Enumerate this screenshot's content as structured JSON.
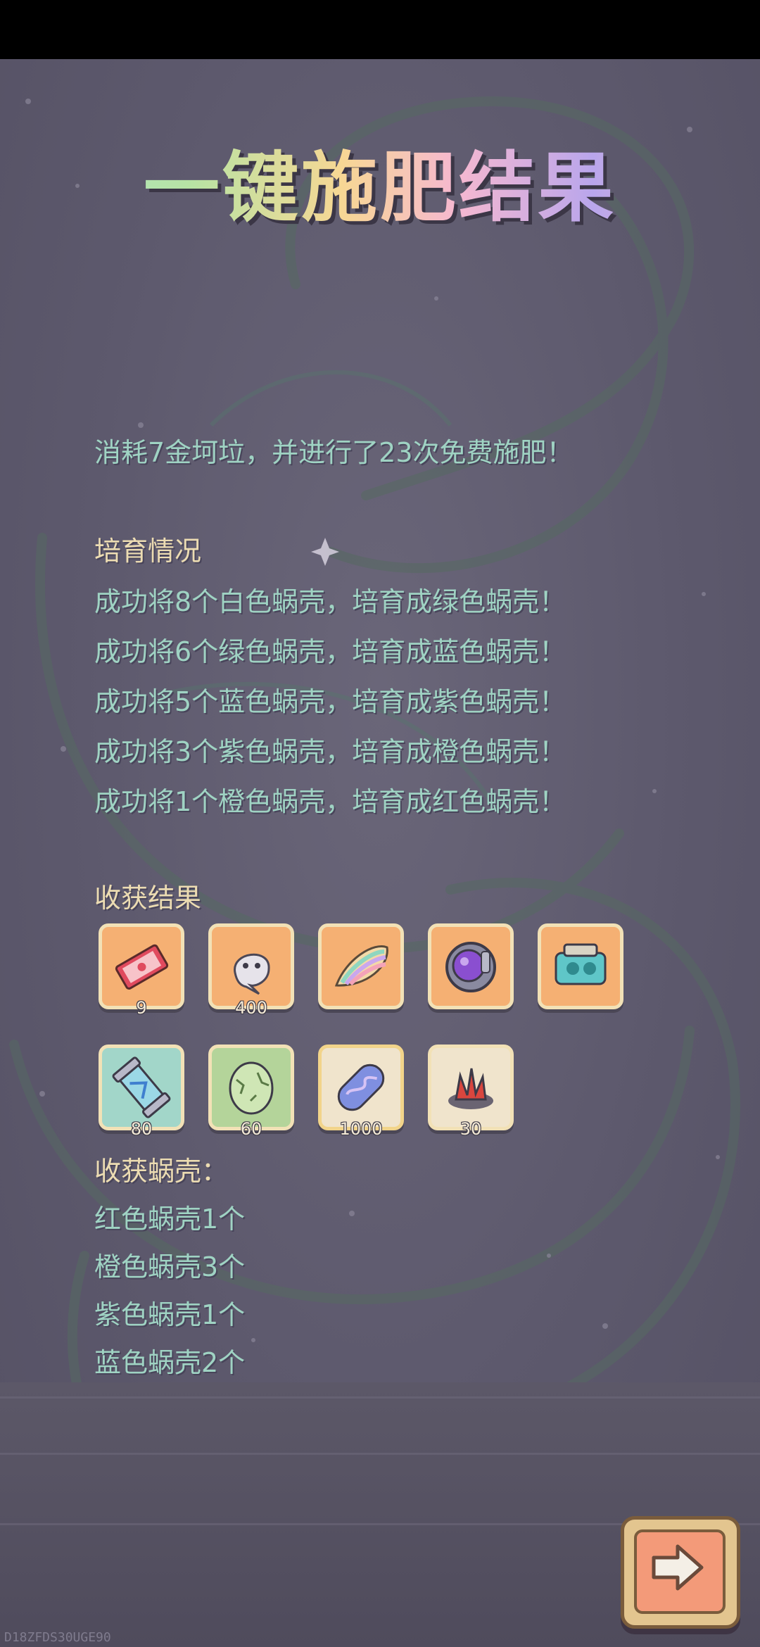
{
  "title": "一键施肥结果",
  "summary": "消耗7金坷垃，并进行了23次免费施肥！",
  "breeding": {
    "heading": "培育情况",
    "lines": [
      "成功将8个白色蜗壳，培育成绿色蜗壳！",
      "成功将6个绿色蜗壳，培育成蓝色蜗壳！",
      "成功将5个蓝色蜗壳，培育成紫色蜗壳！",
      "成功将3个紫色蜗壳，培育成橙色蜗壳！",
      "成功将1个橙色蜗壳，培育成红色蜗壳！"
    ]
  },
  "harvest": {
    "heading": "收获结果",
    "items": [
      {
        "icon": "ticket-icon",
        "count": "9"
      },
      {
        "icon": "ghost-icon",
        "count": "400"
      },
      {
        "icon": "rainbow-shell-icon",
        "count": ""
      },
      {
        "icon": "purple-orb-icon",
        "count": ""
      },
      {
        "icon": "teal-machine-icon",
        "count": ""
      },
      {
        "icon": "capsule-tube-icon",
        "count": "80"
      },
      {
        "icon": "green-egg-icon",
        "count": "60"
      },
      {
        "icon": "purple-pill-icon",
        "count": "1000"
      },
      {
        "icon": "red-crystal-icon",
        "count": "30"
      }
    ]
  },
  "shells": {
    "heading": "收获蜗壳：",
    "lines": [
      "红色蜗壳1个",
      "橙色蜗壳3个",
      "紫色蜗壳1个",
      "蓝色蜗壳2个"
    ]
  },
  "watermark": "D18ZFDS30UGE90",
  "next_button": {
    "icon": "right-arrow-icon"
  },
  "colors": {
    "text_teal": "#9fd3c3",
    "heading_cream": "#ecdcb2",
    "background": "#5e5a70"
  }
}
